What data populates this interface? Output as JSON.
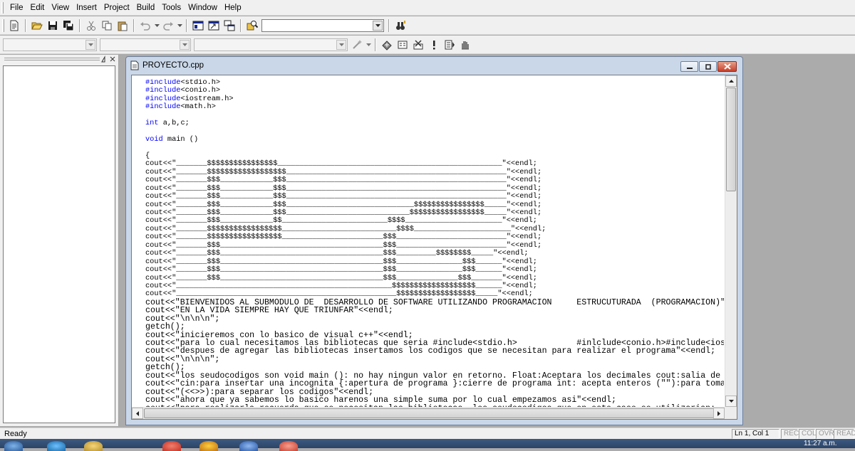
{
  "menu": {
    "items": [
      "File",
      "Edit",
      "View",
      "Insert",
      "Project",
      "Build",
      "Tools",
      "Window",
      "Help"
    ]
  },
  "toolbar": {
    "find_combo_value": "",
    "class_combo_value": "",
    "filter_combo_value": "",
    "members_combo_value": ""
  },
  "editor": {
    "title": "PROYECTO.cpp",
    "code_lines": [
      {
        "kw": "#include",
        "rest": "<stdio.h>"
      },
      {
        "kw": "#include",
        "rest": "<conio.h>"
      },
      {
        "kw": "#include",
        "rest": "<iostream.h>"
      },
      {
        "kw": "#include",
        "rest": "<math.h>"
      },
      {
        "kw": "",
        "rest": ""
      },
      {
        "kw": "int",
        "rest": " a,b,c;"
      },
      {
        "kw": "",
        "rest": ""
      },
      {
        "kw": "void",
        "rest": " main ()"
      },
      {
        "kw": "",
        "rest": ""
      },
      {
        "kw": "",
        "rest": "{"
      },
      {
        "kw": "",
        "rest": "cout<<\"_______$$$$$$$$$$$$$$$$___________________________________________________\"<<endl;"
      },
      {
        "kw": "",
        "rest": "cout<<\"_______$$$$$$$$$$$$$$$$$$__________________________________________________\"<<endl;"
      },
      {
        "kw": "",
        "rest": "cout<<\"_______$$$____________$$$__________________________________________________\"<<endl;"
      },
      {
        "kw": "",
        "rest": "cout<<\"_______$$$____________$$$__________________________________________________\"<<endl;"
      },
      {
        "kw": "",
        "rest": "cout<<\"_______$$$____________$$$__________________________________________________\"<<endl;"
      },
      {
        "kw": "",
        "rest": "cout<<\"_______$$$____________$$$_____________________________$$$$$$$$$$$$$$$$_____\"<<endl;"
      },
      {
        "kw": "",
        "rest": "cout<<\"_______$$$____________$$$____________________________$$$$$$$$$$$$$$$$$_____\"<<endl;"
      },
      {
        "kw": "",
        "rest": "cout<<\"_______$$$____________$$________________________$$$$______________________\"<<endl;"
      },
      {
        "kw": "",
        "rest": "cout<<\"_______$$$$$$$$$$$$$$$$$__________________________$$$$______________________\"<<endl;"
      },
      {
        "kw": "",
        "rest": "cout<<\"_______$$$$$$$$$$$$$$$$$_______________________$$$_________________________\"<<endl;"
      },
      {
        "kw": "",
        "rest": "cout<<\"_______$$$_____________________________________$$$_________________________\"<<endl;"
      },
      {
        "kw": "",
        "rest": "cout<<\"_______$$$_____________________________________$$$_________$$$$$$$$_____\"<<endl;"
      },
      {
        "kw": "",
        "rest": "cout<<\"_______$$$_____________________________________$$$_______________$$$______\"<<endl;"
      },
      {
        "kw": "",
        "rest": "cout<<\"_______$$$_____________________________________$$$_______________$$$______\"<<endl;"
      },
      {
        "kw": "",
        "rest": "cout<<\"_______$$$_____________________________________$$$______________$$$_______\"<<endl;"
      },
      {
        "kw": "",
        "rest": "cout<<\"_________________________________________________$$$$$$$$$$$$$$$$$$$______\"<<endl;"
      },
      {
        "kw": "",
        "rest": "cout<<\"__________________________________________________$$$$$$$$$$$$$$$$$$_____\"<<endl;"
      },
      {
        "kw": "",
        "rest": "cout<<\"BIENVENIDOS AL SUBMODULO DE  DESARROLLO DE SOFTWARE UTILIZANDO PROGRAMACION     ESTRUCUTURADA  (PROGRAMACION)\"",
        "big": true
      },
      {
        "kw": "",
        "rest": "cout<<\"EN LA VIDA SIEMPRE HAY QUE TRIUNFAR\"<<endl;",
        "big": true
      },
      {
        "kw": "",
        "rest": "cout<<\"\\n\\n\\n\";",
        "big": true
      },
      {
        "kw": "",
        "rest": "getch();",
        "big": true
      },
      {
        "kw": "",
        "rest": "cout<<\"inicieremos con lo basico de visual c++\"<<endl;",
        "big": true
      },
      {
        "kw": "",
        "rest": "cout<<\"para lo cual necesitamos las bibliotecas que seria #include<stdio.h>            #inlclude<conio.h>#include<ios",
        "big": true
      },
      {
        "kw": "",
        "rest": "cout<<\"despues de agregar las bibliotecas insertamos los codigos que se necesitan para realizar el programa\"<<endl;",
        "big": true
      },
      {
        "kw": "",
        "rest": "cout<<\"\\n\\n\\n\";",
        "big": true
      },
      {
        "kw": "",
        "rest": "getch();",
        "big": true
      },
      {
        "kw": "",
        "rest": "cout<<\"los seudocodigos son void main (): no hay ningun valor en retorno. Float:Aceptara los decimales cout:salia de",
        "big": true
      },
      {
        "kw": "",
        "rest": "cout<<\"cin:para insertar una incognita {:apertura de programa }:cierre de programa int: acepta enteros (\"\"):para toma",
        "big": true
      },
      {
        "kw": "",
        "rest": "cout<<\"(<<>>):para separar los codigos\"<<endl;",
        "big": true
      },
      {
        "kw": "",
        "rest": "cout<<\"ahora que ya sabemos lo basico harenos una simple suma por lo cual empezamos asi\"<<endl;",
        "big": true
      },
      {
        "kw": "",
        "rest": "cout<<\"para realizarla recuerda que se necesitan las bibliotecas, los seudocodigos que en este caso se utilizarian: ",
        "big": true
      }
    ]
  },
  "statusbar": {
    "text": "Ready",
    "position": "Ln 1, Col 1",
    "indicators": [
      "REC",
      "COL",
      "OVR",
      "READ"
    ]
  },
  "taskbar": {
    "clock": "11:27 a.m."
  },
  "colors": {
    "keyword": "#0000ff",
    "frame": "#c9d7e9",
    "desktop_bg": "#ababab"
  }
}
